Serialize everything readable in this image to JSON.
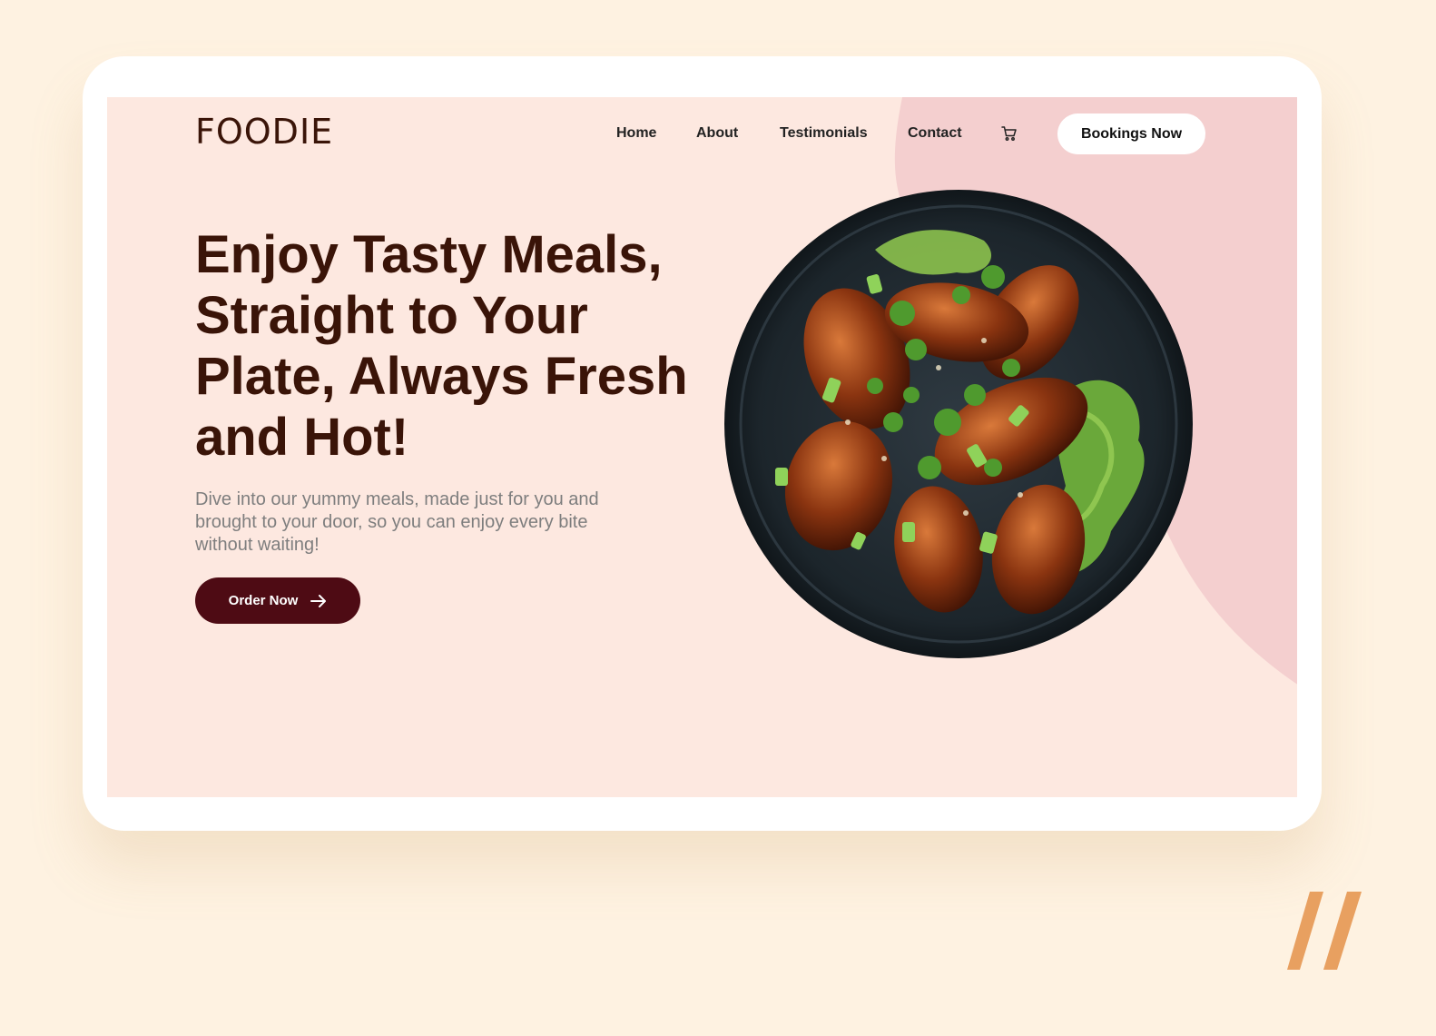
{
  "brand": {
    "logo": "FOODIE"
  },
  "nav": {
    "links": [
      {
        "label": "Home"
      },
      {
        "label": "About"
      },
      {
        "label": "Testimonials"
      },
      {
        "label": "Contact"
      }
    ],
    "cart_icon": "cart-icon",
    "cta_label": "Bookings Now"
  },
  "hero": {
    "title": "Enjoy Tasty Meals, Straight to Your Plate, Always Fresh and Hot!",
    "subtitle": "Dive into our yummy meals, made just for you and brought to your door, so you can enjoy every bite without waiting!",
    "cta_label": "Order Now",
    "cta_icon": "arrow-right-icon",
    "image": "plate-of-glazed-chicken-wings"
  },
  "colors": {
    "page_bg": "#fef2e1",
    "screen_bg": "#fde8e0",
    "accent_blob": "#f4cfcf",
    "heading": "#3a1408",
    "primary_button": "#4e0b14",
    "brand_mark": "#e8a060"
  }
}
